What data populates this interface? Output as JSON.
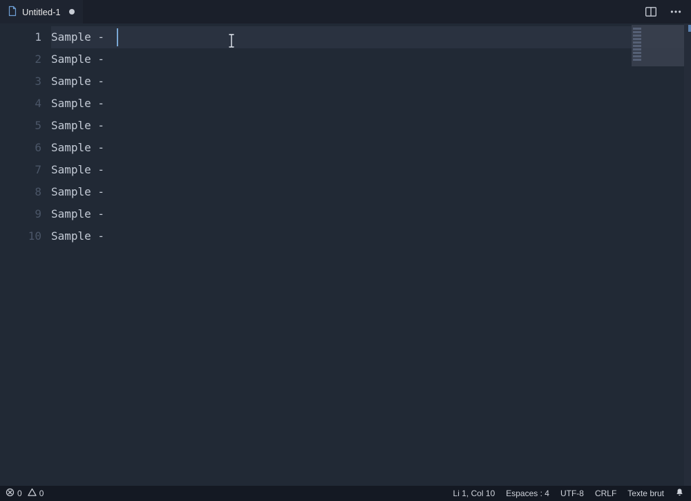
{
  "tab": {
    "title": "Untitled-1",
    "dirty": true
  },
  "editor": {
    "lines": [
      "Sample -",
      "Sample -",
      "Sample -",
      "Sample -",
      "Sample -",
      "Sample -",
      "Sample -",
      "Sample -",
      "Sample -",
      "Sample -"
    ],
    "currentLine": 1,
    "caretColumn": 10
  },
  "status": {
    "errors": "0",
    "warnings": "0",
    "line_col": "Li 1, Col 10",
    "indent": "Espaces : 4",
    "encoding": "UTF-8",
    "eol": "CRLF",
    "language": "Texte brut"
  }
}
